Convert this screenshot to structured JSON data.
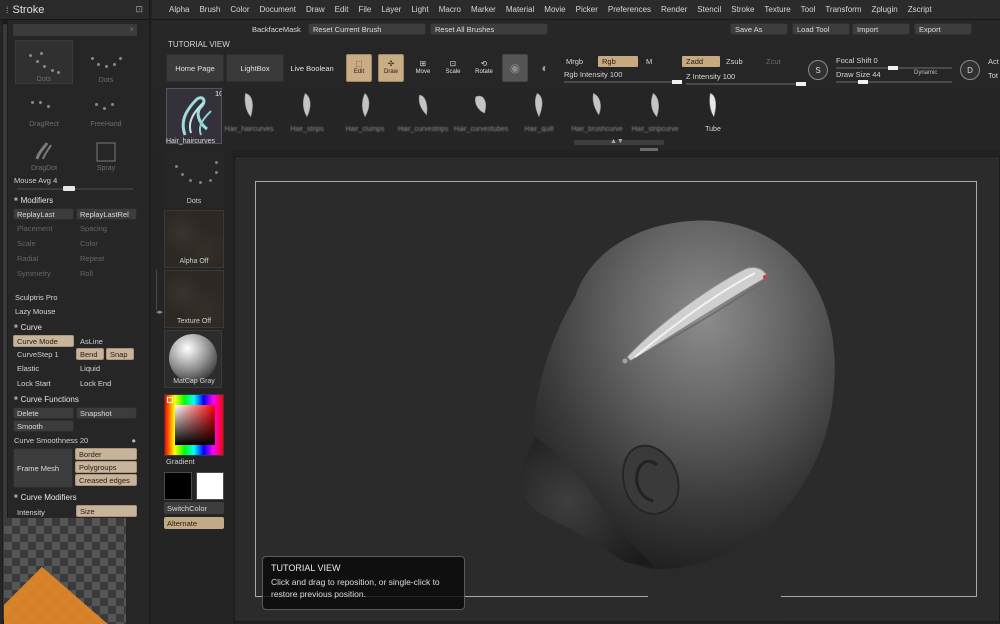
{
  "tray": {
    "title": "Stroke",
    "stroke_types": [
      {
        "label": "Dots",
        "selected": false
      },
      {
        "label": "Dots",
        "selected": true
      },
      {
        "label": "DragRect",
        "selected": false
      },
      {
        "label": "FreeHand",
        "selected": false
      },
      {
        "label": "DragDot",
        "selected": false
      },
      {
        "label": "Spray",
        "selected": false
      },
      {
        "label": "Radial",
        "selected": false
      },
      {
        "label": "Rect",
        "selected": false
      }
    ],
    "mouse_avg_label": "Mouse Avg",
    "mouse_avg_value": "4",
    "modifiers_header": "Modifiers",
    "replay_last": "ReplayLast",
    "replay_last_rel": "ReplayLastRel",
    "dim_rows": [
      "Placement",
      "Spacing",
      "Scale",
      "Color",
      "Radial",
      "Repeat",
      "Symmetry",
      "Roll"
    ],
    "sculptris_pro": "Sculptris Pro",
    "lazy_mouse": "Lazy Mouse",
    "curve_header": "Curve",
    "curve_mode": "Curve Mode",
    "asline": "AsLine",
    "curve_step_label": "CurveStep",
    "curve_step_value": "1",
    "bend": "Bend",
    "snap": "Snap",
    "elastic": "Elastic",
    "liquid": "Liquid",
    "lock_start": "Lock Start",
    "lock_end": "Lock End",
    "curve_functions_header": "Curve Functions",
    "delete": "Delete",
    "snapshot": "Snapshot",
    "smooth": "Smooth",
    "curve_smoothness_label": "Curve Smoothness",
    "curve_smoothness_value": "20",
    "frame_mesh": "Frame Mesh",
    "border": "Border",
    "polygroups": "Polygroups",
    "creased_edges": "Creased edges",
    "curve_modifiers_header": "Curve Modifiers",
    "intensity": "Intensity",
    "size": "Size"
  },
  "menu": [
    "Alpha",
    "Brush",
    "Color",
    "Document",
    "Draw",
    "Edit",
    "File",
    "Layer",
    "Light",
    "Macro",
    "Marker",
    "Material",
    "Movie",
    "Picker",
    "Preferences",
    "Render",
    "Stencil",
    "Stroke",
    "Texture",
    "Tool",
    "Transform",
    "Zplugin",
    "Zscript"
  ],
  "toolbar2": {
    "backface_mask": "BackfaceMask",
    "reset_current_brush": "Reset Current Brush",
    "reset_all_brushes": "Reset All Brushes",
    "save_as": "Save As",
    "load_tool": "Load Tool",
    "import": "Import",
    "export": "Export"
  },
  "shelf": {
    "tutorial_view": "TUTORIAL VIEW",
    "home_page": "Home Page",
    "lightbox": "LightBox",
    "live_boolean": "Live Boolean",
    "edit": "Edit",
    "draw": "Draw",
    "move": "Move",
    "scale": "Scale",
    "rotate": "Rotate",
    "mrgb": "Mrgb",
    "rgb": "Rgb",
    "m": "M",
    "zadd": "Zadd",
    "zsub": "Zsub",
    "zcut": "Zcut",
    "rgb_intensity_label": "Rgb Intensity",
    "rgb_intensity_value": "100",
    "z_intensity_label": "Z Intensity",
    "z_intensity_value": "100",
    "focal_shift_label": "Focal Shift",
    "focal_shift_value": "0",
    "draw_size_label": "Draw Size",
    "draw_size_value": "44",
    "dynamic": "Dynamic",
    "s_glyph": "S",
    "d_glyph": "D",
    "act_label": "Act",
    "tot_label": "Tot"
  },
  "brushes": {
    "current_name": "Hair_haircurves",
    "count": "10",
    "items": [
      {
        "name": "Hair_haircurves",
        "blurred": true
      },
      {
        "name": "Hair_strips",
        "blurred": true
      },
      {
        "name": "Hair_clumps",
        "blurred": true
      },
      {
        "name": "Hair_curvestrips",
        "blurred": true
      },
      {
        "name": "Hair_curvestubes",
        "blurred": true
      },
      {
        "name": "Hair_quill",
        "blurred": true
      },
      {
        "name": "Hair_brushcurve",
        "blurred": true
      },
      {
        "name": "Hair_stripcurve",
        "blurred": true
      },
      {
        "name": "Tube",
        "blurred": false
      }
    ]
  },
  "leftshelf": {
    "dots": "Dots",
    "alpha_off": "Alpha Off",
    "texture_off": "Texture Off",
    "matcap_gray": "MatCap Gray",
    "gradient": "Gradient",
    "switch_color": "SwitchColor",
    "alternate": "Alternate",
    "main_color": "#000000",
    "secondary_color": "#ffffff"
  },
  "tooltip": {
    "title": "TUTORIAL VIEW",
    "body": "Click and drag to reposition, or single-click to restore previous position."
  },
  "colors": {
    "accent": "#c8aa80",
    "curve_highlight": "#d8d8d8",
    "orange_mod": "#e18728"
  }
}
